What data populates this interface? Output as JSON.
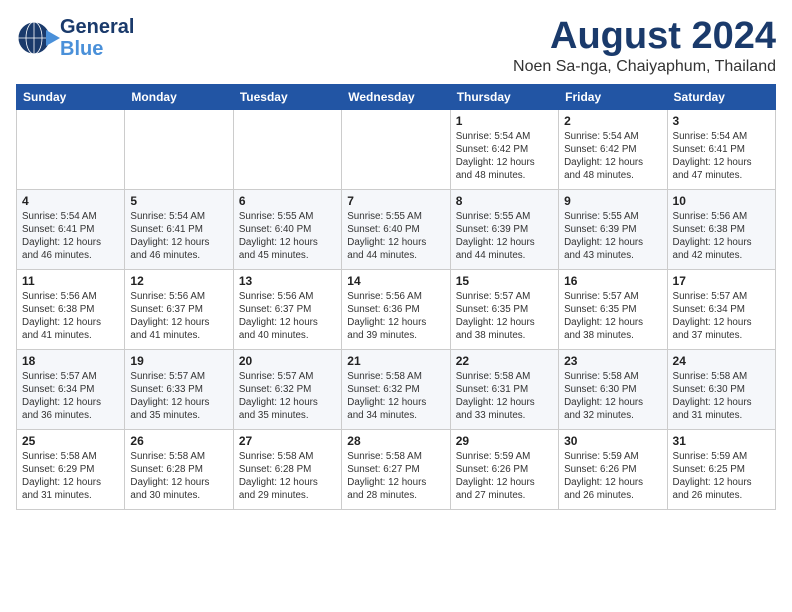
{
  "header": {
    "logo_line1": "General",
    "logo_line2": "Blue",
    "title": "August 2024",
    "subtitle": "Noen Sa-nga, Chaiyaphum, Thailand"
  },
  "days_of_week": [
    "Sunday",
    "Monday",
    "Tuesday",
    "Wednesday",
    "Thursday",
    "Friday",
    "Saturday"
  ],
  "weeks": [
    [
      {
        "day": "",
        "info": ""
      },
      {
        "day": "",
        "info": ""
      },
      {
        "day": "",
        "info": ""
      },
      {
        "day": "",
        "info": ""
      },
      {
        "day": "1",
        "info": "Sunrise: 5:54 AM\nSunset: 6:42 PM\nDaylight: 12 hours\nand 48 minutes."
      },
      {
        "day": "2",
        "info": "Sunrise: 5:54 AM\nSunset: 6:42 PM\nDaylight: 12 hours\nand 48 minutes."
      },
      {
        "day": "3",
        "info": "Sunrise: 5:54 AM\nSunset: 6:41 PM\nDaylight: 12 hours\nand 47 minutes."
      }
    ],
    [
      {
        "day": "4",
        "info": "Sunrise: 5:54 AM\nSunset: 6:41 PM\nDaylight: 12 hours\nand 46 minutes."
      },
      {
        "day": "5",
        "info": "Sunrise: 5:54 AM\nSunset: 6:41 PM\nDaylight: 12 hours\nand 46 minutes."
      },
      {
        "day": "6",
        "info": "Sunrise: 5:55 AM\nSunset: 6:40 PM\nDaylight: 12 hours\nand 45 minutes."
      },
      {
        "day": "7",
        "info": "Sunrise: 5:55 AM\nSunset: 6:40 PM\nDaylight: 12 hours\nand 44 minutes."
      },
      {
        "day": "8",
        "info": "Sunrise: 5:55 AM\nSunset: 6:39 PM\nDaylight: 12 hours\nand 44 minutes."
      },
      {
        "day": "9",
        "info": "Sunrise: 5:55 AM\nSunset: 6:39 PM\nDaylight: 12 hours\nand 43 minutes."
      },
      {
        "day": "10",
        "info": "Sunrise: 5:56 AM\nSunset: 6:38 PM\nDaylight: 12 hours\nand 42 minutes."
      }
    ],
    [
      {
        "day": "11",
        "info": "Sunrise: 5:56 AM\nSunset: 6:38 PM\nDaylight: 12 hours\nand 41 minutes."
      },
      {
        "day": "12",
        "info": "Sunrise: 5:56 AM\nSunset: 6:37 PM\nDaylight: 12 hours\nand 41 minutes."
      },
      {
        "day": "13",
        "info": "Sunrise: 5:56 AM\nSunset: 6:37 PM\nDaylight: 12 hours\nand 40 minutes."
      },
      {
        "day": "14",
        "info": "Sunrise: 5:56 AM\nSunset: 6:36 PM\nDaylight: 12 hours\nand 39 minutes."
      },
      {
        "day": "15",
        "info": "Sunrise: 5:57 AM\nSunset: 6:35 PM\nDaylight: 12 hours\nand 38 minutes."
      },
      {
        "day": "16",
        "info": "Sunrise: 5:57 AM\nSunset: 6:35 PM\nDaylight: 12 hours\nand 38 minutes."
      },
      {
        "day": "17",
        "info": "Sunrise: 5:57 AM\nSunset: 6:34 PM\nDaylight: 12 hours\nand 37 minutes."
      }
    ],
    [
      {
        "day": "18",
        "info": "Sunrise: 5:57 AM\nSunset: 6:34 PM\nDaylight: 12 hours\nand 36 minutes."
      },
      {
        "day": "19",
        "info": "Sunrise: 5:57 AM\nSunset: 6:33 PM\nDaylight: 12 hours\nand 35 minutes."
      },
      {
        "day": "20",
        "info": "Sunrise: 5:57 AM\nSunset: 6:32 PM\nDaylight: 12 hours\nand 35 minutes."
      },
      {
        "day": "21",
        "info": "Sunrise: 5:58 AM\nSunset: 6:32 PM\nDaylight: 12 hours\nand 34 minutes."
      },
      {
        "day": "22",
        "info": "Sunrise: 5:58 AM\nSunset: 6:31 PM\nDaylight: 12 hours\nand 33 minutes."
      },
      {
        "day": "23",
        "info": "Sunrise: 5:58 AM\nSunset: 6:30 PM\nDaylight: 12 hours\nand 32 minutes."
      },
      {
        "day": "24",
        "info": "Sunrise: 5:58 AM\nSunset: 6:30 PM\nDaylight: 12 hours\nand 31 minutes."
      }
    ],
    [
      {
        "day": "25",
        "info": "Sunrise: 5:58 AM\nSunset: 6:29 PM\nDaylight: 12 hours\nand 31 minutes."
      },
      {
        "day": "26",
        "info": "Sunrise: 5:58 AM\nSunset: 6:28 PM\nDaylight: 12 hours\nand 30 minutes."
      },
      {
        "day": "27",
        "info": "Sunrise: 5:58 AM\nSunset: 6:28 PM\nDaylight: 12 hours\nand 29 minutes."
      },
      {
        "day": "28",
        "info": "Sunrise: 5:58 AM\nSunset: 6:27 PM\nDaylight: 12 hours\nand 28 minutes."
      },
      {
        "day": "29",
        "info": "Sunrise: 5:59 AM\nSunset: 6:26 PM\nDaylight: 12 hours\nand 27 minutes."
      },
      {
        "day": "30",
        "info": "Sunrise: 5:59 AM\nSunset: 6:26 PM\nDaylight: 12 hours\nand 26 minutes."
      },
      {
        "day": "31",
        "info": "Sunrise: 5:59 AM\nSunset: 6:25 PM\nDaylight: 12 hours\nand 26 minutes."
      }
    ]
  ]
}
